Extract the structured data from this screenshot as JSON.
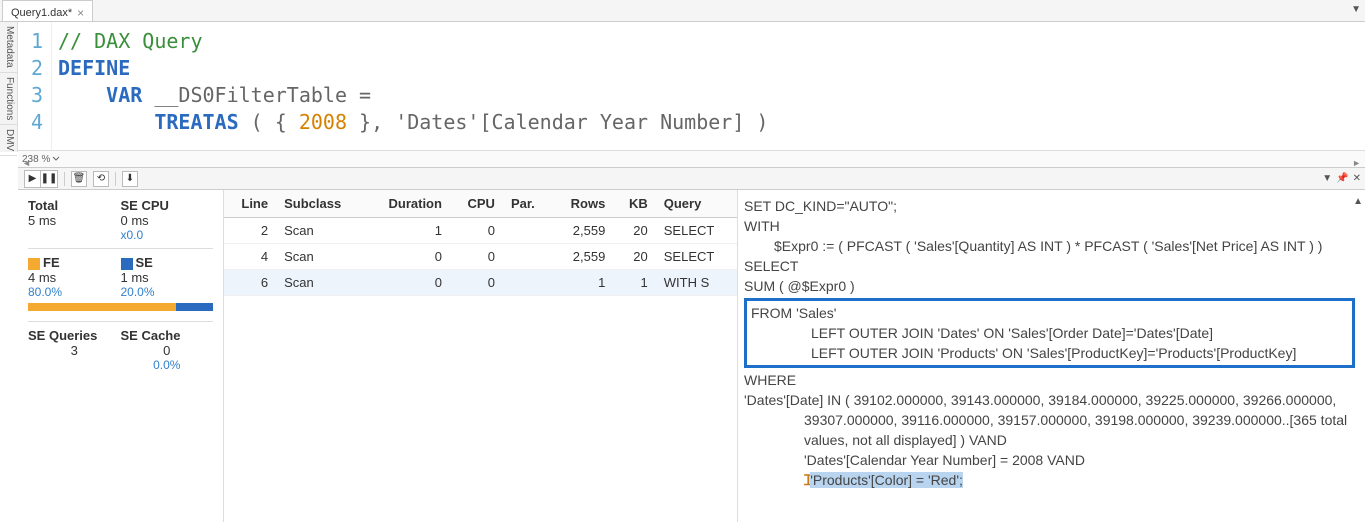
{
  "tab": {
    "title": "Query1.dax*"
  },
  "sideTabs": [
    "Metadata",
    "Functions",
    "DMV"
  ],
  "editor": {
    "lines": [
      {
        "n": 1,
        "tokens": [
          [
            "comment",
            "// DAX Query"
          ]
        ]
      },
      {
        "n": 2,
        "tokens": [
          [
            "keyword",
            "DEFINE"
          ]
        ]
      },
      {
        "n": 3,
        "tokens": [
          [
            "plain",
            "    "
          ],
          [
            "keyword",
            "VAR"
          ],
          [
            "plain",
            " __DS0FilterTable ="
          ]
        ]
      },
      {
        "n": 4,
        "tokens": [
          [
            "plain",
            "        "
          ],
          [
            "func",
            "TREATAS"
          ],
          [
            "plain",
            " ( { "
          ],
          [
            "number",
            "2008"
          ],
          [
            "plain",
            " }, "
          ],
          [
            "string",
            "'Dates'[Calendar Year Number]"
          ],
          [
            "plain",
            " )"
          ]
        ]
      }
    ]
  },
  "zoom": "238 %",
  "stats": {
    "total_label": "Total",
    "total_val": "5 ms",
    "secpu_label": "SE CPU",
    "secpu_val": "0 ms",
    "secpu_sub": "x0.0",
    "fe_label": "FE",
    "fe_val": "4 ms",
    "fe_pct": "80.0%",
    "se_label": "SE",
    "se_val": "1 ms",
    "se_pct": "20.0%",
    "blue_width": "20%",
    "seq_label": "SE Queries",
    "seq_val": "3",
    "sec_label": "SE Cache",
    "sec_val": "0",
    "sec_pct": "0.0%"
  },
  "table": {
    "headers": [
      "Line",
      "Subclass",
      "Duration",
      "CPU",
      "Par.",
      "Rows",
      "KB",
      "Query"
    ],
    "rows": [
      {
        "line": "2",
        "subclass": "Scan",
        "duration": "1",
        "cpu": "0",
        "par": "",
        "rows": "2,559",
        "kb": "20",
        "query": "SELECT"
      },
      {
        "line": "4",
        "subclass": "Scan",
        "duration": "0",
        "cpu": "0",
        "par": "",
        "rows": "2,559",
        "kb": "20",
        "query": "SELECT"
      },
      {
        "line": "6",
        "subclass": "Scan",
        "duration": "0",
        "cpu": "0",
        "par": "",
        "rows": "1",
        "kb": "1",
        "query": "WITH S",
        "selected": true
      }
    ]
  },
  "sql": {
    "l1": "SET DC_KIND=\"AUTO\";",
    "l2": "WITH",
    "l3": "$Expr0 := ( PFCAST ( 'Sales'[Quantity] AS  INT ) * PFCAST ( 'Sales'[Net Price] AS  INT )  )",
    "l4": "SELECT",
    "l5": "SUM ( @$Expr0 )",
    "box1": "FROM 'Sales'",
    "box2": "LEFT OUTER JOIN 'Dates' ON 'Sales'[Order Date]='Dates'[Date]",
    "box3": "LEFT OUTER JOIN 'Products' ON 'Sales'[ProductKey]='Products'[ProductKey]",
    "l6": "WHERE",
    "l7": "'Dates'[Date] IN ( 39102.000000, 39143.000000, 39184.000000, 39225.000000, 39266.000000, 39307.000000, 39116.000000, 39157.000000, 39198.000000, 39239.000000..[365 total values, not all displayed] ) VAND",
    "l8": "'Dates'[Calendar Year Number] = 2008 VAND",
    "l9": "'Products'[Color] = 'Red';"
  }
}
